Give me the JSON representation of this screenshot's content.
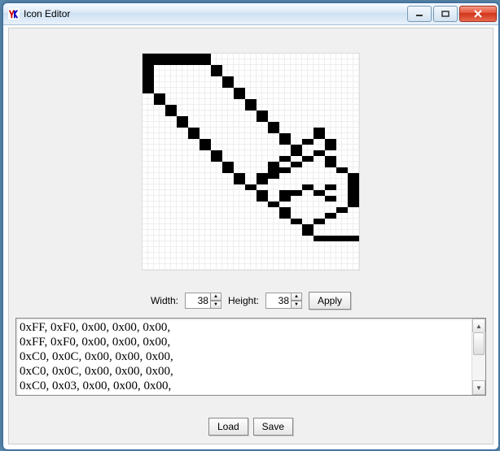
{
  "window": {
    "title": "Icon Editor"
  },
  "controls": {
    "width_label": "Width:",
    "height_label": "Height:",
    "width_value": "38",
    "height_value": "38",
    "apply_label": "Apply"
  },
  "data_lines": [
    "0xFF, 0xF0, 0x00, 0x00, 0x00,",
    "0xFF, 0xF0, 0x00, 0x00, 0x00,",
    "0xC0, 0x0C, 0x00, 0x00, 0x00,",
    "0xC0, 0x0C, 0x00, 0x00, 0x00,",
    "0xC0, 0x03, 0x00, 0x00, 0x00,"
  ],
  "buttons": {
    "load": "Load",
    "save": "Save"
  },
  "grid": {
    "width": 38,
    "height": 38
  },
  "bitmap_rows_hex": [
    "FFF0000000",
    "FFF0000000",
    "C00C000000",
    "C00C000000",
    "C003000000",
    "C003000000",
    "C000C00000",
    "3000C00000",
    "3000300000",
    "0C00300000",
    "0C000C0000",
    "03000C0000",
    "0300030000",
    "00C0030300",
    "00C000C300",
    "003000CCC0",
    "00300030C0",
    "000C003300",
    "000C00CCC0",
    "00030330C0",
    "000303C030",
    "0000CF000C",
    "0000CC000C",
    "0000300CCC",
    "00000CF30C",
    "00000CC0CC",
    "000003000C",
    "000000C033",
    "000000C0C3",
    "0000003303",
    "0000000C03",
    "0000000C03",
    "00000003FC",
    "0000000000",
    "0000000000",
    "0000000000",
    "0000000000",
    "0000000000"
  ]
}
